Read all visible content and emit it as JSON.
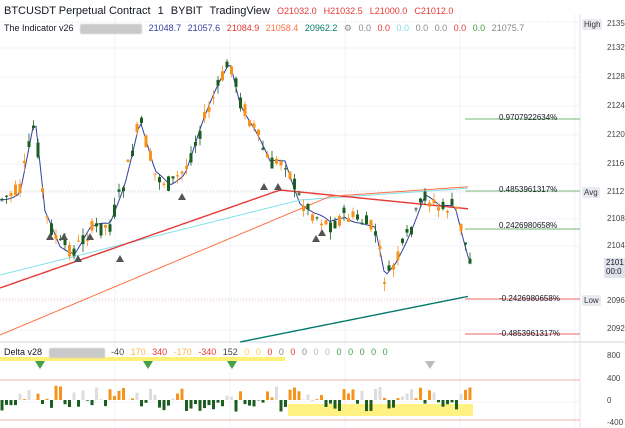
{
  "header": {
    "symbol": "BTCUSDT Perpetual Contract",
    "interval": "1",
    "exchange": "BYBIT",
    "source": "TradingView",
    "ohlc": {
      "open": "O21032.0",
      "high": "H21032.5",
      "low": "L21000.0",
      "close": "C21012.0"
    }
  },
  "indicator1": {
    "name": "The Indicator v26",
    "values": [
      "21048.7",
      "21057.6",
      "21084.9",
      "21058.4",
      "20962.2"
    ],
    "zeros": [
      "0.0",
      "0.0",
      "0.0",
      "0.0",
      "0.0",
      "0.0",
      "0.0"
    ],
    "last": "21075.7"
  },
  "indicator2": {
    "name": "Delta v28",
    "values": [
      "-40",
      "170",
      "340",
      "-170",
      "-340",
      "152",
      "0",
      "0",
      "0",
      "0",
      "0",
      "0",
      "0",
      "0",
      "0",
      "0",
      "0",
      "0",
      "0"
    ]
  },
  "price_axis": {
    "labels": [
      "2135",
      "2132",
      "2128",
      "2124",
      "2120",
      "2116",
      "2112",
      "2108",
      "2104",
      "2100",
      "2096",
      "2092"
    ],
    "last_price": "2101",
    "countdown": "00:0",
    "high_tag": "High",
    "avg_tag": "Avg",
    "low_tag": "Low"
  },
  "delta_axis": {
    "labels": [
      "800",
      "400",
      "0",
      "-400"
    ]
  },
  "fib_levels": [
    {
      "label": "0.9707922634%",
      "color": "#43a047"
    },
    {
      "label": "0.4853961317%",
      "color": "#43a047"
    },
    {
      "label": "0.2426980658%",
      "color": "#43a047"
    },
    {
      "label": "-0.2426980658%",
      "color": "#e53935"
    },
    {
      "label": "-0.4853961317%",
      "color": "#e53935"
    }
  ],
  "colors": {
    "up": "#f7931a",
    "down": "#1b5e20",
    "ema_fast": "#303f9f",
    "ema_mid": "#e53935",
    "ema_slow": "#ff7043",
    "ema_long": "#00796b",
    "vwap": "#80deea"
  }
}
